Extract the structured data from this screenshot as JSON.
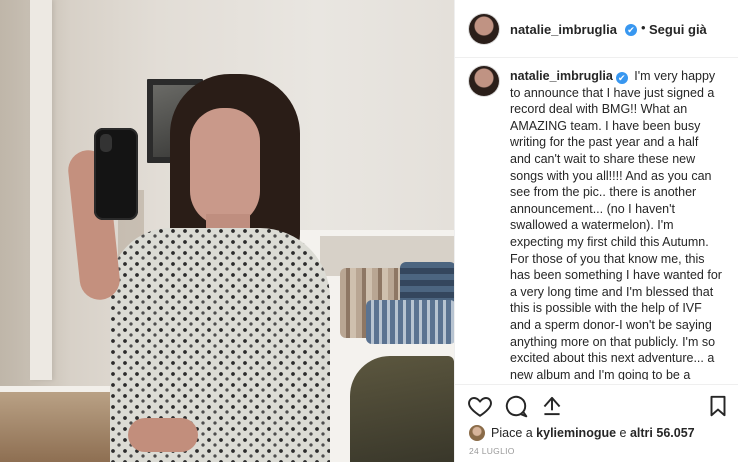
{
  "header": {
    "username": "natalie_imbruglia",
    "verified_icon": "✔",
    "separator": "•",
    "follow_label": "Segui già"
  },
  "caption": {
    "username": "natalie_imbruglia",
    "verified_icon": "✔",
    "text": "I'm very happy to announce that I have just signed a record deal with BMG!! What an AMAZING team. I have been busy writing for the past year and a half and can't wait to share these new songs with you all!!!! And as you can see from the pic.. there is another announcement... (no I haven't swallowed a watermelon). I'm expecting my first child this Autumn. For those of you that know me, this has been something I have wanted for a very long time and I'm blessed that this is possible with the help of IVF and a sperm donor-I won't be saying anything more on that publicly. I'm so excited about this next adventure... a new album and I'm going to be a mum! 🎶 🀫🀫🎉😍❤️✨"
  },
  "actions": {
    "like_icon": "heart-icon",
    "comment_icon": "comment-icon",
    "share_icon": "share-icon",
    "save_icon": "bookmark-icon"
  },
  "likes": {
    "prefix": "Piace a ",
    "user": "kylieminogue",
    "middle": " e ",
    "others": "altri 56.057"
  },
  "date": "24 LUGLIO",
  "colors": {
    "accent": "#3897f0",
    "text": "#262626",
    "muted": "#999999",
    "border": "#efefef"
  }
}
